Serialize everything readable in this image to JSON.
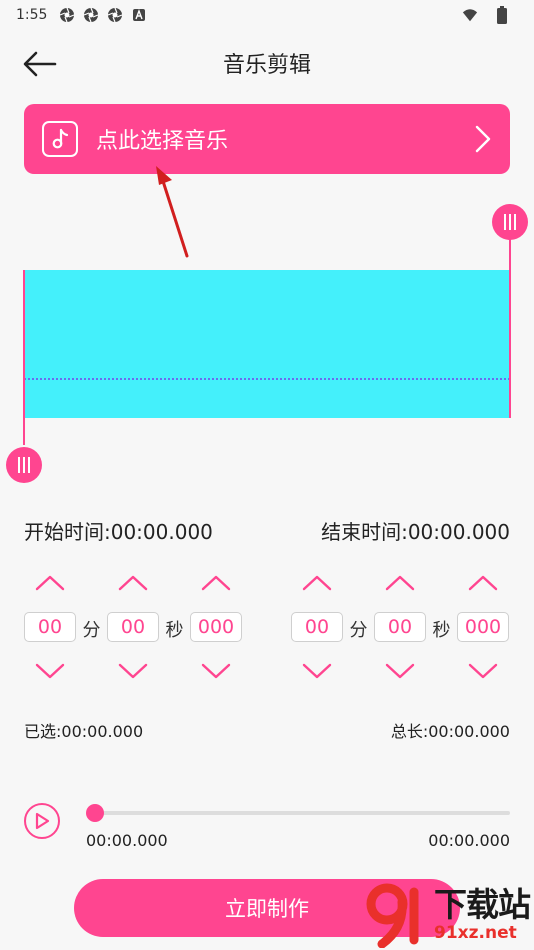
{
  "status_bar": {
    "time": "1:55",
    "icons": [
      "aperture-icon",
      "aperture-icon",
      "aperture-icon",
      "a-badge-icon"
    ],
    "right_icons": [
      "wifi-icon",
      "battery-icon"
    ]
  },
  "header": {
    "back_icon": "arrow-left-icon",
    "title": "音乐剪辑"
  },
  "pick_music": {
    "label": "点此选择音乐",
    "icon": "music-note-icon",
    "chevron": "chevron-right-icon"
  },
  "times": {
    "start": "开始时间:00:00.000",
    "end": "结束时间:00:00.000"
  },
  "start_stepper": {
    "minutes": "00",
    "seconds": "00",
    "millis": "000",
    "unit_min": "分",
    "unit_sec": "秒"
  },
  "end_stepper": {
    "minutes": "00",
    "seconds": "00",
    "millis": "000",
    "unit_min": "分",
    "unit_sec": "秒"
  },
  "selection": {
    "selected": "已选:00:00.000",
    "total": "总长:00:00.000"
  },
  "player": {
    "position": "00:00.000",
    "duration": "00:00.000",
    "progress": 0
  },
  "make_button": "立即制作",
  "watermark": {
    "big": "下载站",
    "small": "91xz.net"
  },
  "colors": {
    "accent": "#ff4590",
    "wave": "#44f0fb",
    "wave_line": "#6a6cf0"
  }
}
